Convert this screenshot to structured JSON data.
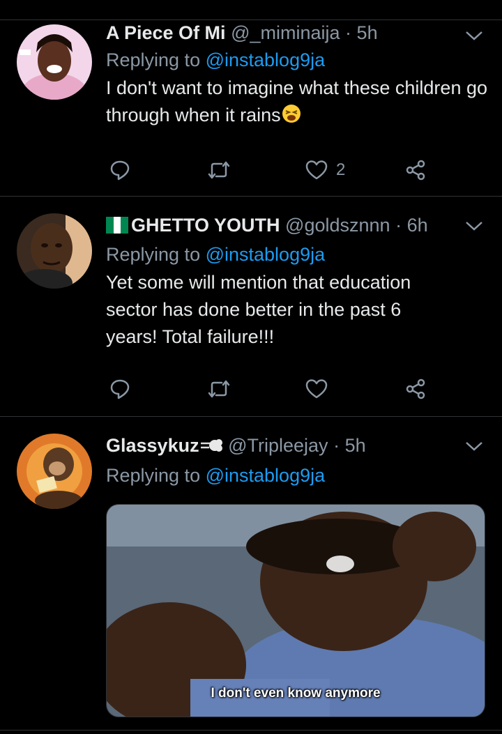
{
  "tweets": [
    {
      "display_name": "A Piece Of Mi",
      "handle": "@_miminaija",
      "separator": "·",
      "time": "5h",
      "replying_prefix": "Replying to ",
      "replying_to": "@instablog9ja",
      "text": "I don't want to imagine what these children go through when it rains",
      "emoji": "tired-face-emoji",
      "like_count": "2"
    },
    {
      "display_name": "GHETTO YOUTH",
      "name_flag": "nigeria-flag-emoji",
      "handle": "@goldsznnn",
      "separator": "·",
      "time": "6h",
      "replying_prefix": "Replying to ",
      "replying_to": "@instablog9ja",
      "text": "Yet some will mention that education sector has done better in the past 6 years! Total failure!!!",
      "like_count": ""
    },
    {
      "display_name": "Glassykuz",
      "name_emoji": "dash-emoji",
      "handle": "@Tripleejay",
      "separator": "·",
      "time": "5h",
      "replying_prefix": "Replying to ",
      "replying_to": "@instablog9ja",
      "media_caption": "I don't even know anymore"
    }
  ],
  "colors": {
    "background": "#000000",
    "divider": "#2f3336",
    "secondary_text": "#8b98a5",
    "mention": "#1d9bf0",
    "primary_text": "#e7e9ea"
  }
}
